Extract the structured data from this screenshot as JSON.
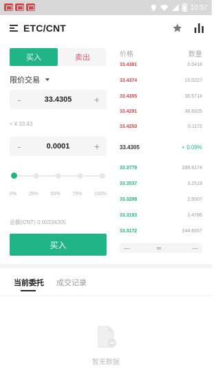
{
  "status_bar": {
    "time": "10:57",
    "colors": {
      "bg": "#d8d8d8",
      "app_icons": "#d9464a"
    }
  },
  "header": {
    "pair": "ETC/CNT",
    "icons": [
      "menu-icon",
      "star-icon",
      "chart-icon"
    ]
  },
  "trade_tabs": {
    "buy": "买入",
    "sell": "卖出"
  },
  "order_type": "限价交易",
  "price_input": {
    "minus": "-",
    "value": "33.4305",
    "plus": "+"
  },
  "approx_value": "≈ ¥ 33.43",
  "amount_input": {
    "minus": "-",
    "value": "0.0001",
    "plus": "+"
  },
  "slider": {
    "level": 0,
    "percent_labels": [
      "0%",
      "25%",
      "50%",
      "75%",
      "100%"
    ]
  },
  "total": "总额(CNT) 0.00334305",
  "buy_button": "买入",
  "orderbook": {
    "price_header": "价格",
    "amount_header": "数量",
    "asks": [
      {
        "price": "33.4381",
        "amount": "0.0418"
      },
      {
        "price": "33.4374",
        "amount": "10.0227"
      },
      {
        "price": "33.4305",
        "amount": "36.5714"
      },
      {
        "price": "33.4291",
        "amount": "36.6925"
      },
      {
        "price": "33.4250",
        "amount": "0.1172"
      }
    ],
    "last_price": "33.4305",
    "change": "+ 0.09%",
    "bids": [
      {
        "price": "33.3779",
        "amount": "289.8174"
      },
      {
        "price": "33.3537",
        "amount": "3.2519"
      },
      {
        "price": "33.3298",
        "amount": "2.5007"
      },
      {
        "price": "33.3193",
        "amount": "2.4786"
      },
      {
        "price": "33.3172",
        "amount": "244.6657"
      }
    ],
    "depth": {
      "left": "—",
      "mid": "═",
      "right": "—"
    },
    "colors": {
      "ask": "#d9464a",
      "bid": "#20b486"
    }
  },
  "bottom_tabs": {
    "current": "当前委托",
    "history": "成交记录"
  },
  "empty_state": {
    "text": "暂无数据",
    "icon": "document-icon"
  },
  "accent_color": "#20b486"
}
